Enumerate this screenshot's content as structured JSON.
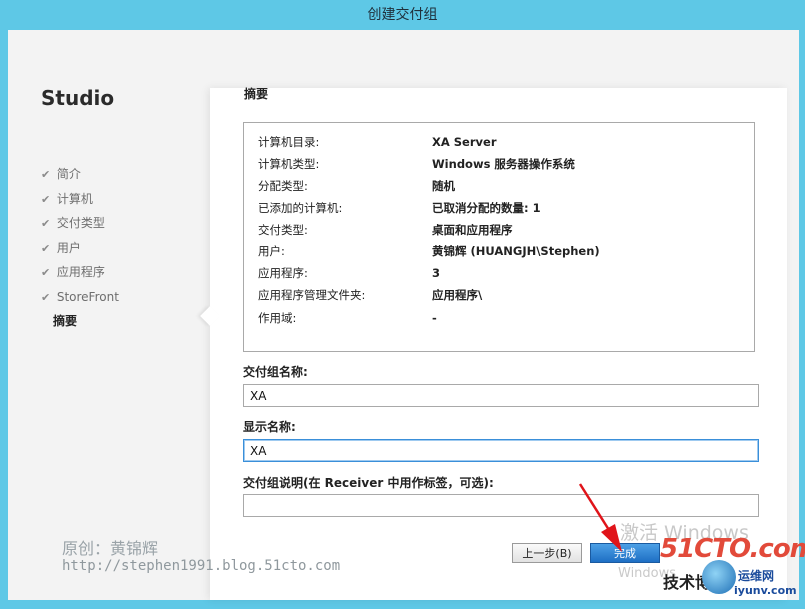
{
  "window": {
    "title": "创建交付组"
  },
  "sidebar": {
    "brand": "Studio",
    "steps": [
      {
        "label": "简介",
        "done": true
      },
      {
        "label": "计算机",
        "done": true
      },
      {
        "label": "交付类型",
        "done": true
      },
      {
        "label": "用户",
        "done": true
      },
      {
        "label": "应用程序",
        "done": true
      },
      {
        "label": "StoreFront",
        "done": true
      },
      {
        "label": "摘要",
        "done": false,
        "current": true
      }
    ],
    "check_glyph": "✔"
  },
  "main": {
    "heading": "摘要",
    "summary": [
      {
        "key": "计算机目录:",
        "value": "XA Server"
      },
      {
        "key": "计算机类型:",
        "value": "Windows 服务器操作系统"
      },
      {
        "key": "分配类型:",
        "value": "随机"
      },
      {
        "key": "已添加的计算机:",
        "value": "已取消分配的数量: 1"
      },
      {
        "key": "交付类型:",
        "value": "桌面和应用程序"
      },
      {
        "key": "用户:",
        "value": "黄锦辉 (HUANGJH\\Stephen)"
      },
      {
        "key": "应用程序:",
        "value": "3"
      },
      {
        "key": "应用程序管理文件夹:",
        "value": "应用程序\\"
      },
      {
        "key": "作用域:",
        "value": "-"
      }
    ],
    "group_name": {
      "label": "交付组名称:",
      "value": "XA"
    },
    "display_name": {
      "label": "显示名称:",
      "value": "XA"
    },
    "description": {
      "label": "交付组说明(在 Receiver 中用作标签，可选):",
      "value": ""
    }
  },
  "buttons": {
    "back": "上一步(B)",
    "finish": "完成"
  },
  "watermarks": {
    "original": "原创：黄锦辉",
    "url": "http://stephen1991.blog.51cto.com",
    "activate": "激活 Windows",
    "windows": "Windows",
    "site_logo": "51CTO.com",
    "site_tagline": "技术博客",
    "yunwei": "运维网",
    "iyunv": "iyunv.com"
  },
  "colors": {
    "frame": "#5ec8e6",
    "accent": "#1e6fc4",
    "arrow": "#e0141a"
  }
}
